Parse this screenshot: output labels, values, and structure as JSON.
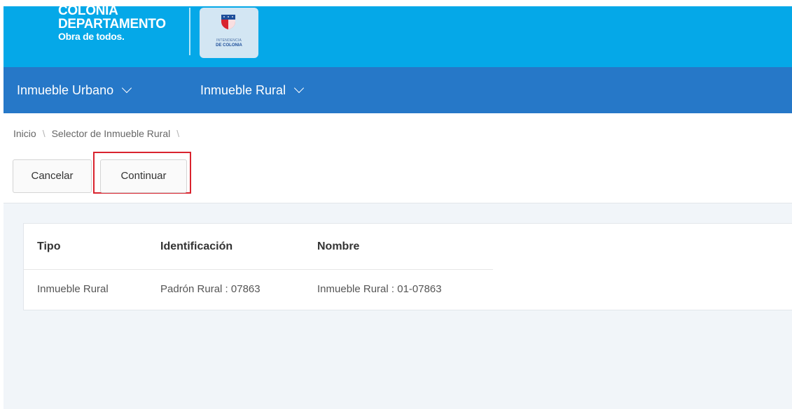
{
  "header": {
    "logo_line1": "COLONIA",
    "logo_line2": "DEPARTAMENTO",
    "logo_line3": "Obra de todos.",
    "seal_line1": "INTENDENCIA",
    "seal_line2": "DE COLONIA",
    "colors": {
      "topbar": "#05a8e8",
      "navbar": "#2678c8"
    }
  },
  "nav": {
    "items": [
      {
        "label": "Inmueble Urbano",
        "icon": "chevron-down-icon"
      },
      {
        "label": "Inmueble Rural",
        "icon": "chevron-down-icon"
      }
    ]
  },
  "breadcrumb": {
    "items": [
      "Inicio",
      "Selector de Inmueble Rural"
    ],
    "separator": "\\"
  },
  "toolbar": {
    "cancel_label": "Cancelar",
    "continue_label": "Continuar",
    "highlight_color": "#d9232e"
  },
  "table": {
    "columns": [
      "Tipo",
      "Identificación",
      "Nombre"
    ],
    "rows": [
      [
        "Inmueble Rural",
        "Padrón Rural : 07863",
        "Inmueble Rural : 01-07863"
      ]
    ]
  }
}
